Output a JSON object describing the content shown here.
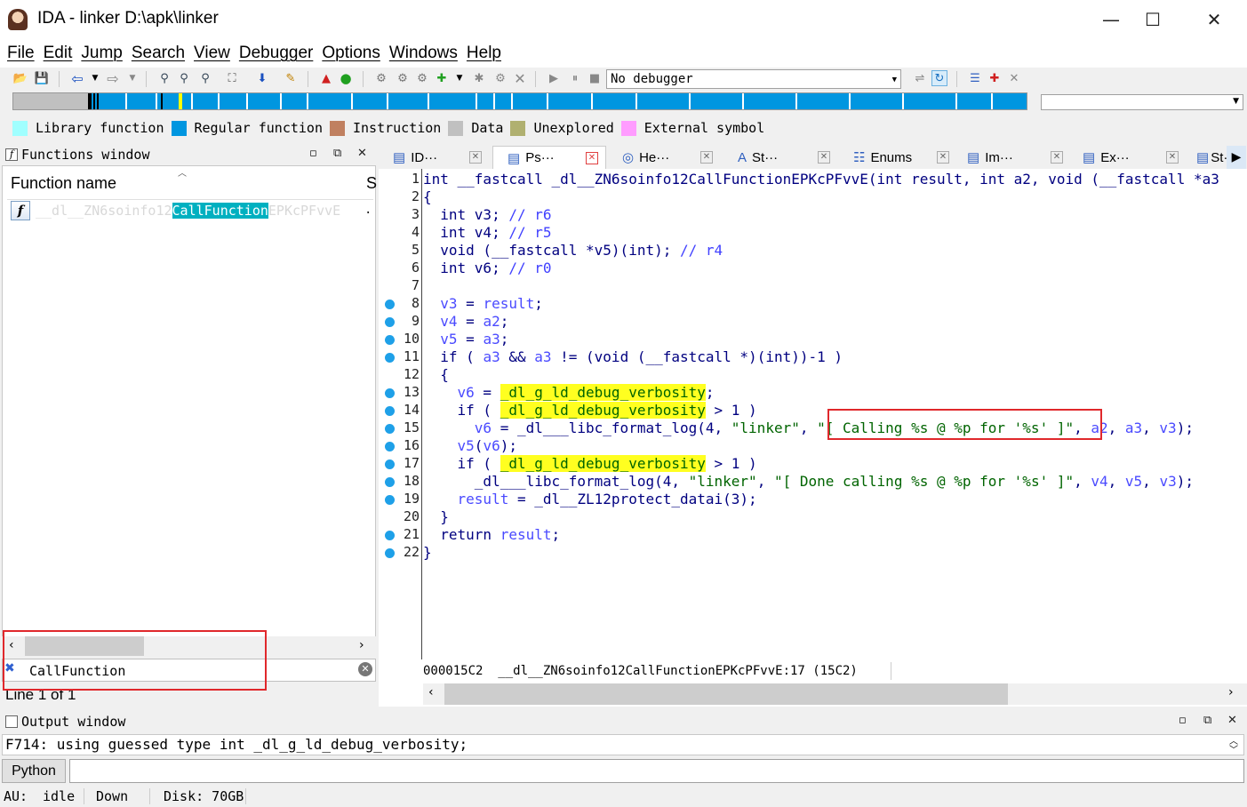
{
  "window": {
    "title": "IDA - linker D:\\apk\\linker",
    "minimize": "—",
    "maximize": "☐",
    "close": "✕"
  },
  "menu": [
    "File",
    "Edit",
    "Jump",
    "Search",
    "View",
    "Debugger",
    "Options",
    "Windows",
    "Help"
  ],
  "toolbar": {
    "debugger_select": "No debugger"
  },
  "legend": [
    {
      "label": "Library function",
      "color": "#a0ffff"
    },
    {
      "label": "Regular function",
      "color": "#0096e0"
    },
    {
      "label": "Instruction",
      "color": "#c08060"
    },
    {
      "label": "Data",
      "color": "#c0c0c0"
    },
    {
      "label": "Unexplored",
      "color": "#b0b070"
    },
    {
      "label": "External symbol",
      "color": "#ff9cff"
    }
  ],
  "functions_window": {
    "title": "Functions window",
    "column_header": "Function name",
    "column_header_2": "S",
    "row": {
      "prefix": "__dl__ZN6soinfo12",
      "match": "CallFunction",
      "suffix": "EPKcPFvvE",
      "segment": "."
    },
    "filter_value": "CallFunction",
    "line_info": "Line 1 of 1"
  },
  "tabs": [
    {
      "label": "ID···",
      "icon": "ida-view-icon"
    },
    {
      "label": "Ps···",
      "icon": "pseudocode-icon",
      "active": true
    },
    {
      "label": "He···",
      "icon": "hex-view-icon"
    },
    {
      "label": "St···",
      "icon": "structures-icon"
    },
    {
      "label": "Enums",
      "icon": "enums-icon"
    },
    {
      "label": "Im···",
      "icon": "imports-icon"
    },
    {
      "label": "Ex···",
      "icon": "exports-icon"
    },
    {
      "label": "St·",
      "icon": "strings-icon"
    }
  ],
  "code": {
    "line_numbers": [
      "1",
      "2",
      "3",
      "4",
      "5",
      "6",
      "7",
      "8",
      "9",
      "10",
      "11",
      "12",
      "13",
      "14",
      "15",
      "16",
      "17",
      "18",
      "19",
      "20",
      "21",
      "22"
    ],
    "l1": "int __fastcall _dl__ZN6soinfo12CallFunctionEPKcPFvvE(int result, int a2, void (__fastcall *a3",
    "l2": "{",
    "l3a": "  int v3; ",
    "l3b": "// r6",
    "l4a": "  int v4; ",
    "l4b": "// r5",
    "l5a": "  void (__fastcall *v5)(int); ",
    "l5b": "// r4",
    "l6a": "  int v6; ",
    "l6b": "// r0",
    "l8a": "  v3",
    "l8b": " = ",
    "l8c": "result",
    "l8d": ";",
    "l9a": "  v4",
    "l9b": " = ",
    "l9c": "a2",
    "l9d": ";",
    "l10a": "  v5",
    "l10b": " = ",
    "l10c": "a3",
    "l10d": ";",
    "l11a": "  if ( ",
    "l11b": "a3",
    "l11c": " && ",
    "l11d": "a3",
    "l11e": " != (void (__fastcall *)(int))-1 )",
    "l12": "  {",
    "l13a": "    v6",
    "l13b": " = ",
    "l13c": "_dl_g_ld_debug_verbosity",
    "l13d": ";",
    "l14a": "    if ( ",
    "l14b": "_dl_g_ld_debug_verbosity",
    "l14c": " > 1 )",
    "l15a": "      v6",
    "l15b": " = _dl___libc_format_log(4, ",
    "l15c": "\"linker\"",
    "l15d": ", ",
    "l15e": "\"[ Calling %s @ %p for '%s' ]\"",
    "l15f": ", ",
    "l15g": "a2",
    "l15h": ", ",
    "l15i": "a3",
    "l15j": ", ",
    "l15k": "v3",
    "l15l": ");",
    "l16a": "    v5",
    "l16b": "(",
    "l16c": "v6",
    "l16d": ");",
    "l17a": "    if ( ",
    "l17b": "_dl_g_ld_debug_verbosity",
    "l17c": " > 1 )",
    "l18a": "      _dl___libc_format_log(4, ",
    "l18b": "\"linker\"",
    "l18c": ", ",
    "l18d": "\"[ Done calling %s @ %p for '%s' ]\"",
    "l18e": ", ",
    "l18f": "v4",
    "l18g": ", ",
    "l18h": "v5",
    "l18i": ", ",
    "l18j": "v3",
    "l18k": ");",
    "l19a": "    result",
    "l19b": " = _dl__ZL12protect_datai(3);",
    "l20": "  }",
    "l21a": "  return ",
    "l21b": "result",
    "l21c": ";",
    "l22": "}"
  },
  "code_status": "000015C2  __dl__ZN6soinfo12CallFunctionEPKcPFvvE:17 (15C2)",
  "output_window": {
    "title": "Output window",
    "text": "F714: using guessed type int _dl_g_ld_debug_verbosity;"
  },
  "python_button": "Python",
  "statusbar": {
    "au": "AU:",
    "state": "idle",
    "direction": "Down",
    "disk": "Disk: 70GB"
  }
}
